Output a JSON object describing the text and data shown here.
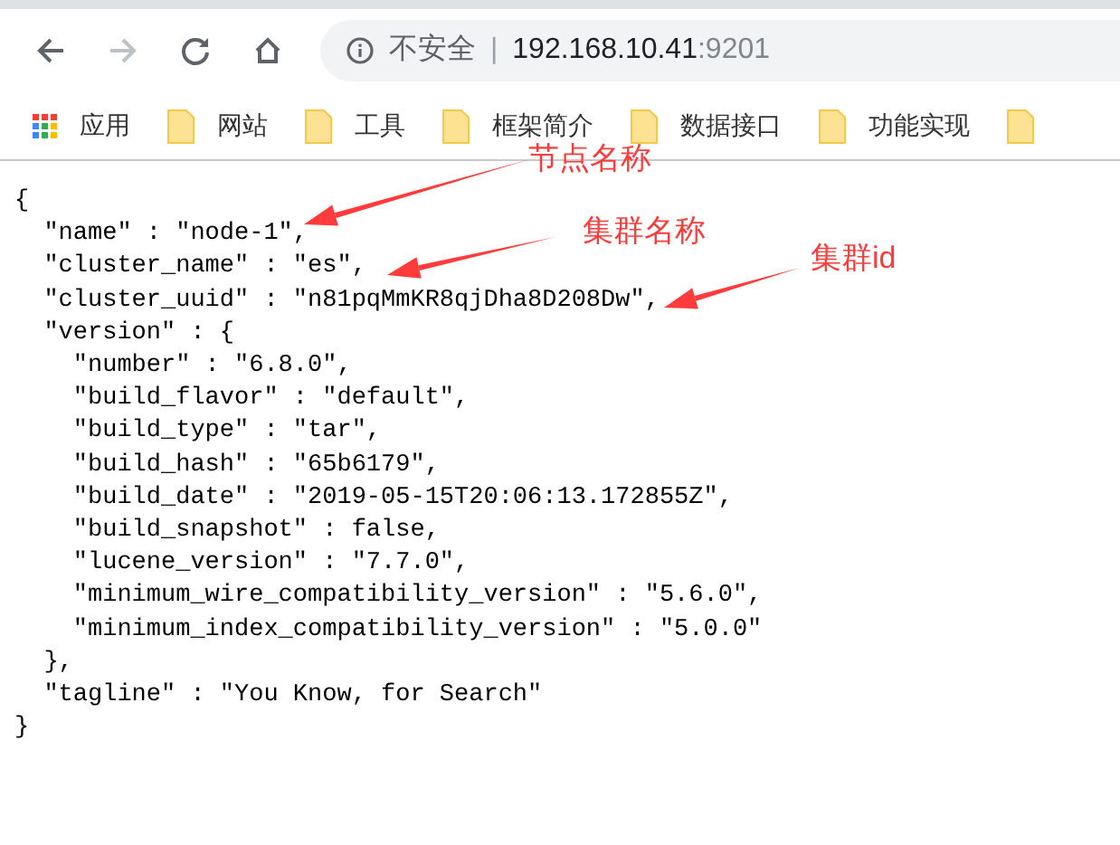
{
  "toolbar": {
    "security_label": "不安全",
    "separator": "|",
    "host": "192.168.10.41",
    "port": ":9201",
    "forward_disabled": true
  },
  "bookmarks": [
    {
      "kind": "apps",
      "label": "应用"
    },
    {
      "kind": "folder",
      "label": "网站"
    },
    {
      "kind": "folder",
      "label": "工具"
    },
    {
      "kind": "folder",
      "label": "框架简介"
    },
    {
      "kind": "folder",
      "label": "数据接口"
    },
    {
      "kind": "folder",
      "label": "功能实现"
    },
    {
      "kind": "folder"
    }
  ],
  "document": {
    "open": "{",
    "close": "}",
    "members": [
      {
        "text": "\"name\" : \"node-1\","
      },
      {
        "text": "\"cluster_name\" : \"es\","
      },
      {
        "text": "\"cluster_uuid\" : \"n81pqMmKR8qjDha8D208Dw\","
      },
      {
        "text": "\"version\" : {",
        "close": "},",
        "children": [
          {
            "text": "\"number\" : \"6.8.0\","
          },
          {
            "text": "\"build_flavor\" : \"default\","
          },
          {
            "text": "\"build_type\" : \"tar\","
          },
          {
            "text": "\"build_hash\" : \"65b6179\","
          },
          {
            "text": "\"build_date\" : \"2019-05-15T20:06:13.172855Z\","
          },
          {
            "text": "\"build_snapshot\" : false,"
          },
          {
            "text": "\"lucene_version\" : \"7.7.0\","
          },
          {
            "text": "\"minimum_wire_compatibility_version\" : \"5.6.0\","
          },
          {
            "text": "\"minimum_index_compatibility_version\" : \"5.0.0\""
          }
        ]
      },
      {
        "text": "\"tagline\" : \"You Know, for Search\""
      }
    ]
  },
  "annotations": [
    {
      "label": "节点名称"
    },
    {
      "label": "集群名称"
    },
    {
      "label": "集群id"
    }
  ]
}
